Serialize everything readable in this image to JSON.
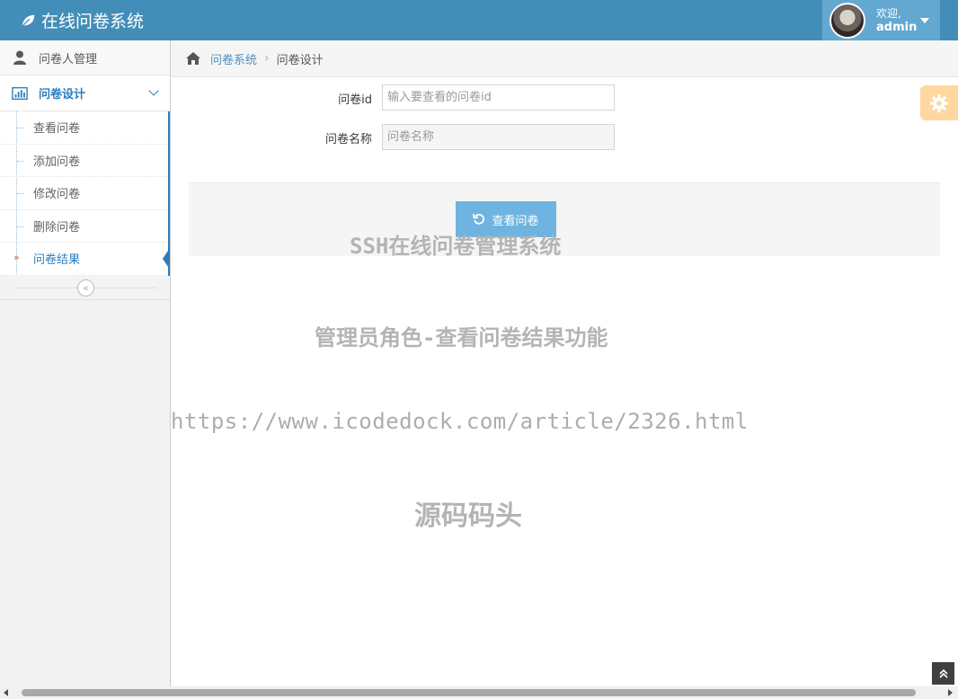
{
  "navbar": {
    "brand": "在线问卷系统",
    "welcome": "欢迎,",
    "username": "admin"
  },
  "sidebar": {
    "items": [
      {
        "label": "问卷人管理",
        "icon": "user-icon"
      },
      {
        "label": "问卷设计",
        "icon": "bar-chart-icon",
        "open": true
      }
    ],
    "submenu": [
      {
        "label": "查看问卷"
      },
      {
        "label": "添加问卷"
      },
      {
        "label": "修改问卷"
      },
      {
        "label": "删除问卷"
      },
      {
        "label": "问卷结果",
        "active": true
      }
    ],
    "collapse_glyph": "«"
  },
  "breadcrumb": {
    "home_icon": "home-icon",
    "link": "问卷系统",
    "separator": "›",
    "current": "问卷设计"
  },
  "form": {
    "id_label": "问卷id",
    "id_placeholder": "输入要查看的问卷id",
    "id_value": "",
    "name_label": "问卷名称",
    "name_placeholder": "问卷名称",
    "name_value": "",
    "submit_label": "查看问卷"
  },
  "watermarks": {
    "line1": "SSH在线问卷管理系统",
    "line2": "管理员角色-查看问卷结果功能",
    "line3": "https://www.icodedock.com/article/2326.html",
    "line4": "源码码头"
  },
  "colors": {
    "navbar": "#438eb9",
    "accent": "#2b7dbc",
    "button": "#6fb3e0",
    "settings": "#ffb752"
  }
}
